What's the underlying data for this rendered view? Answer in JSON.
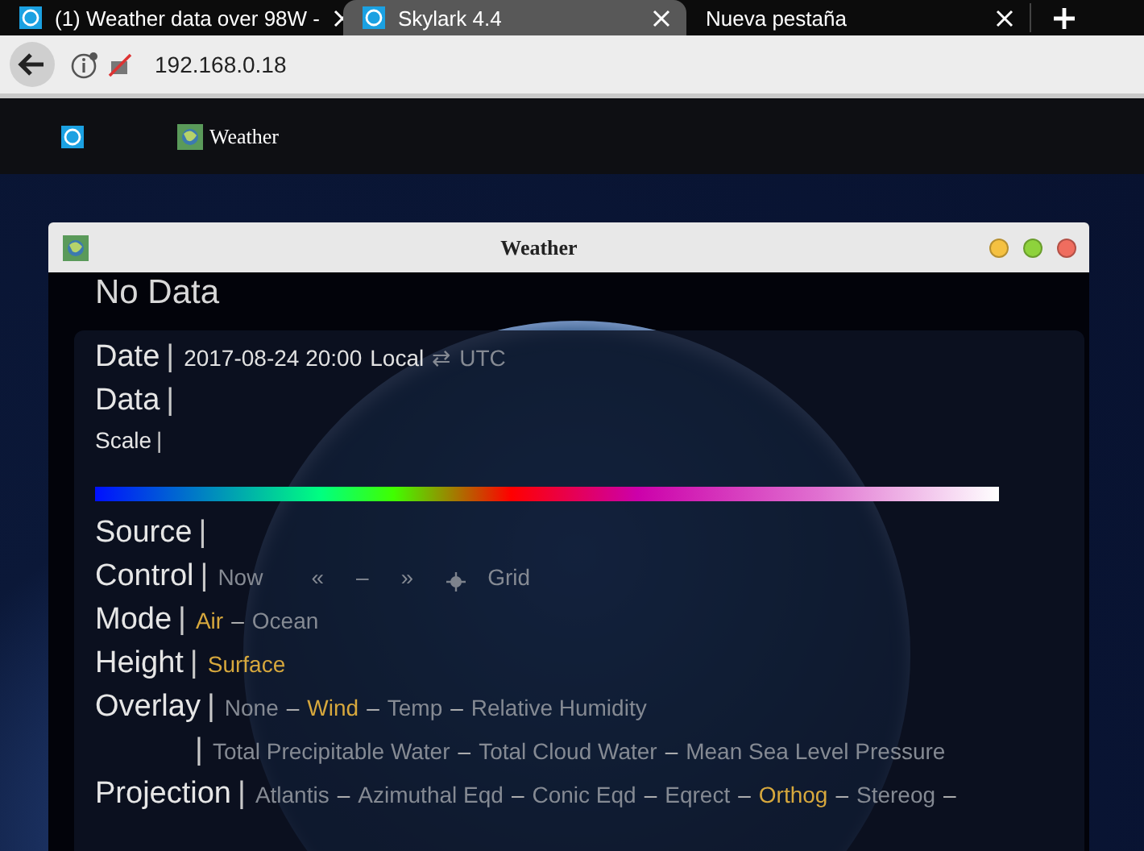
{
  "browser": {
    "tabs": [
      {
        "title": "(1) Weather data over 98W -",
        "selected": false
      },
      {
        "title": "Skylark 4.4",
        "selected": true
      },
      {
        "title": "Nueva pestaña",
        "selected": false
      }
    ],
    "address": "192.168.0.18"
  },
  "app_bar": {
    "items": [
      {
        "kind": "home"
      },
      {
        "kind": "app",
        "label": "Weather"
      }
    ]
  },
  "window": {
    "title": "Weather",
    "heading": "No Data",
    "rows": [
      {
        "kind": "main",
        "label": "Date",
        "bar": "|",
        "items": [
          {
            "kind": "value",
            "text": "2017-08-24 20:00"
          },
          {
            "kind": "value",
            "text": "Local"
          },
          {
            "kind": "option",
            "text": "⇄",
            "selected": false
          },
          {
            "kind": "option",
            "text": "UTC",
            "selected": false
          }
        ]
      },
      {
        "kind": "main",
        "label": "Data",
        "bar": "|",
        "items": []
      },
      {
        "kind": "minor",
        "label": "Scale",
        "bar": "|",
        "items": []
      },
      {
        "kind": "colorbar",
        "items": []
      },
      {
        "kind": "main",
        "label": "Source",
        "bar": "|",
        "items": []
      },
      {
        "kind": "main",
        "label": "Control",
        "bar": "|",
        "items": [
          {
            "kind": "option",
            "text": "Now",
            "selected": false
          },
          {
            "kind": "gap"
          },
          {
            "kind": "option",
            "text": "«",
            "selected": false
          },
          {
            "kind": "option",
            "text": "–",
            "selected": false
          },
          {
            "kind": "option",
            "text": "»",
            "selected": false
          },
          {
            "kind": "icon"
          },
          {
            "kind": "option",
            "text": "Grid",
            "selected": false
          }
        ]
      },
      {
        "kind": "main",
        "label": "Mode",
        "bar": "|",
        "items": [
          {
            "kind": "option",
            "text": "Air",
            "selected": true
          },
          {
            "kind": "sep",
            "text": "–"
          },
          {
            "kind": "option",
            "text": "Ocean",
            "selected": false
          }
        ]
      },
      {
        "kind": "main",
        "label": "Height",
        "bar": "|",
        "items": [
          {
            "kind": "option",
            "text": "Surface",
            "selected": true
          }
        ]
      },
      {
        "kind": "main",
        "label": "Overlay",
        "bar": "|",
        "items": [
          {
            "kind": "option",
            "text": "None",
            "selected": false
          },
          {
            "kind": "sep",
            "text": "–"
          },
          {
            "kind": "option",
            "text": "Wind",
            "selected": true
          },
          {
            "kind": "sep",
            "text": "–"
          },
          {
            "kind": "option",
            "text": "Temp",
            "selected": false
          },
          {
            "kind": "sep",
            "text": "–"
          },
          {
            "kind": "option",
            "text": "Relative Humidity",
            "selected": false
          }
        ]
      },
      {
        "kind": "continuation",
        "bar": "|",
        "items": [
          {
            "kind": "option",
            "text": "Total Precipitable Water",
            "selected": false
          },
          {
            "kind": "sep",
            "text": "–"
          },
          {
            "kind": "option",
            "text": "Total Cloud Water",
            "selected": false
          },
          {
            "kind": "sep",
            "text": "–"
          },
          {
            "kind": "option",
            "text": "Mean Sea Level Pressure",
            "selected": false
          }
        ]
      },
      {
        "kind": "main",
        "label": "Projection",
        "bar": "|",
        "items": [
          {
            "kind": "option",
            "text": "Atlantis",
            "selected": false
          },
          {
            "kind": "sep",
            "text": "–"
          },
          {
            "kind": "option",
            "text": "Azimuthal Eqd",
            "selected": false
          },
          {
            "kind": "sep",
            "text": "–"
          },
          {
            "kind": "option",
            "text": "Conic Eqd",
            "selected": false
          },
          {
            "kind": "sep",
            "text": "–"
          },
          {
            "kind": "option",
            "text": "Eqrect",
            "selected": false
          },
          {
            "kind": "sep",
            "text": "–"
          },
          {
            "kind": "option",
            "text": "Orthog",
            "selected": true
          },
          {
            "kind": "sep",
            "text": "–"
          },
          {
            "kind": "option",
            "text": "Stereog",
            "selected": false
          },
          {
            "kind": "sep",
            "text": "–"
          }
        ]
      }
    ]
  }
}
